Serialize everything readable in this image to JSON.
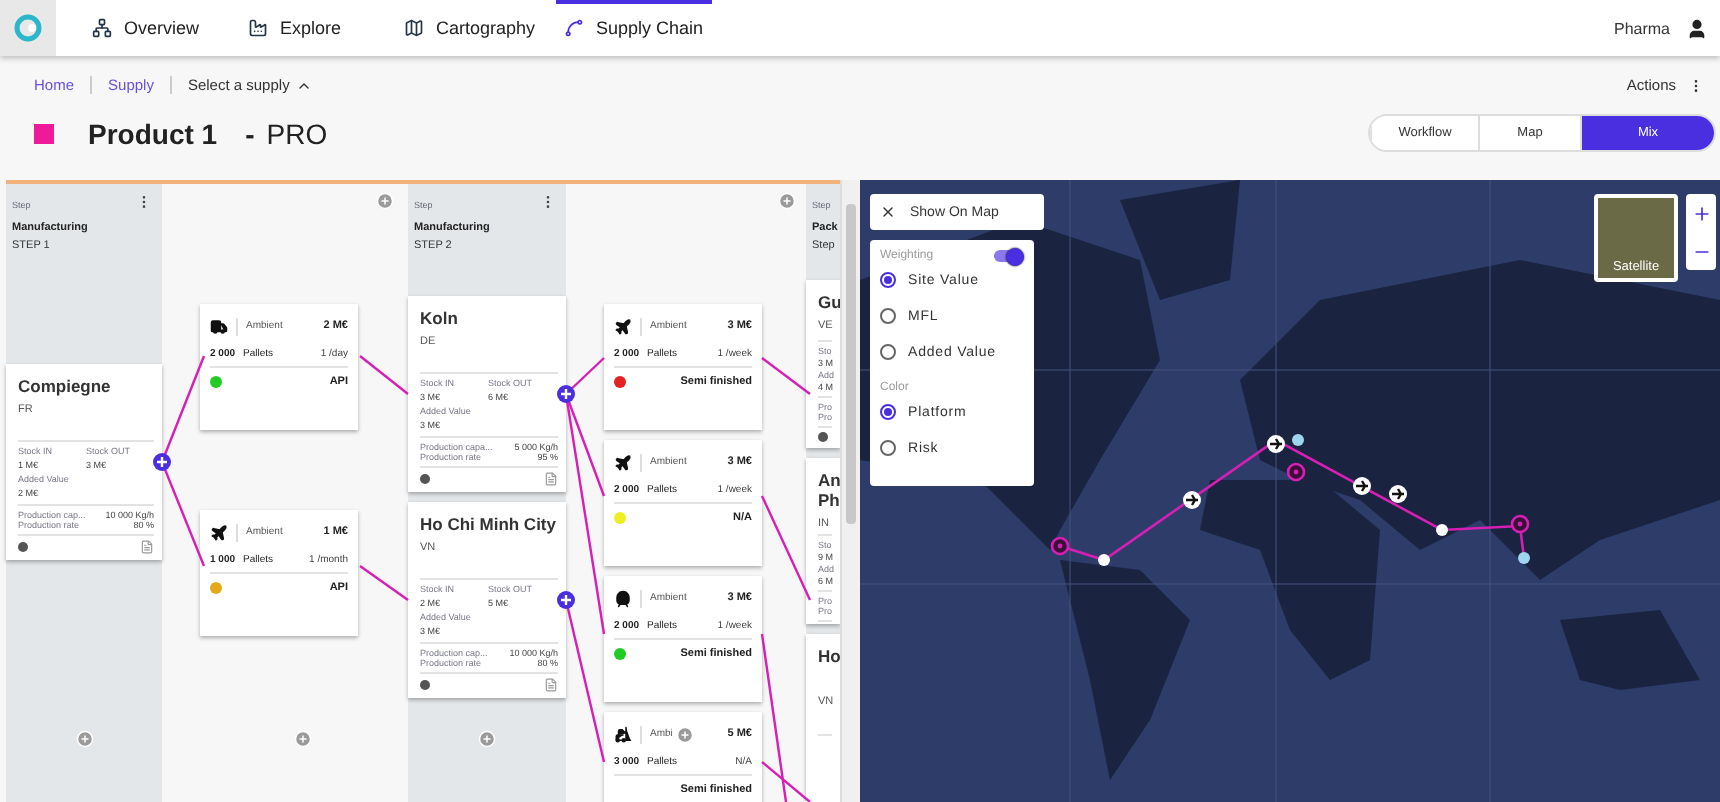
{
  "nav": {
    "items": [
      {
        "label": "Overview",
        "kind": "overview",
        "selected": false
      },
      {
        "label": "Explore",
        "kind": "explore",
        "selected": false
      },
      {
        "label": "Cartography",
        "kind": "cartography",
        "selected": false
      },
      {
        "label": "Supply Chain",
        "kind": "supply",
        "selected": true
      }
    ],
    "user": "Pharma"
  },
  "breadcrumbs": [
    {
      "label": "Home"
    },
    {
      "label": "Supply"
    }
  ],
  "supply_select": "Select a supply",
  "actions": "Actions",
  "product": {
    "name": "Product 1",
    "separator": "-",
    "code": "PRO",
    "color": "#ee1a9a"
  },
  "view_toggle": [
    {
      "label": "Workflow",
      "selected": false
    },
    {
      "label": "Map",
      "selected": false
    },
    {
      "label": "Mix",
      "selected": true
    }
  ],
  "steps": [
    {
      "caption": "Step",
      "type": "Manufacturing",
      "name": "STEP 1",
      "sites": [
        {
          "name": "Compiegne",
          "country": "FR",
          "stock_in_label": "Stock IN",
          "stock_in": "1 M€",
          "stock_out_label": "Stock OUT",
          "stock_out": "3 M€",
          "added_value_label": "Added Value",
          "added_value": "2 M€",
          "capacity_label": "Production cap...",
          "capacity": "10 000 Kg/h",
          "rate_label": "Production rate",
          "rate": "80 %"
        }
      ]
    },
    {
      "caption": "Step",
      "type": "Manufacturing",
      "name": "STEP 2",
      "sites": [
        {
          "name": "Koln",
          "country": "DE",
          "stock_in_label": "Stock IN",
          "stock_in": "3 M€",
          "stock_out_label": "Stock OUT",
          "stock_out": "6 M€",
          "added_value_label": "Added Value",
          "added_value": "3 M€",
          "capacity_label": "Production capa...",
          "capacity": "5 000 Kg/h",
          "rate_label": "Production rate",
          "rate": "95 %"
        },
        {
          "name": "Ho Chi Minh City",
          "country": "VN",
          "stock_in_label": "Stock IN",
          "stock_in": "2 M€",
          "stock_out_label": "Stock OUT",
          "stock_out": "5 M€",
          "added_value_label": "Added Value",
          "added_value": "3 M€",
          "capacity_label": "Production cap...",
          "capacity": "10 000 Kg/h",
          "rate_label": "Production rate",
          "rate": "80 %"
        }
      ]
    },
    {
      "caption": "Step",
      "type": "Pack",
      "name": "Step",
      "sites": [
        {
          "name": "Gu",
          "country": "VE",
          "stock_in_label": "Sto",
          "stock_in": "3 M",
          "added_value_label": "Add",
          "added_value": "4 M",
          "capacity_label": "Pro",
          "rate_label": "Pro"
        },
        {
          "name": "An Ph",
          "country": "IN",
          "stock_in_label": "Sto",
          "stock_in": "9 M",
          "added_value_label": "Add",
          "added_value": "6 M",
          "capacity_label": "Pro",
          "rate_label": "Pro"
        },
        {
          "name": "Ho",
          "country": "VN"
        }
      ]
    }
  ],
  "flows": [
    {
      "transports": [
        {
          "kind": "truck",
          "temp": "Ambient",
          "cost": "2 M€",
          "quantity": "2 000",
          "unit": "Pallets",
          "frequency": "1 /day",
          "color": "#22cc22",
          "product": "API"
        },
        {
          "kind": "plane",
          "temp": "Ambient",
          "cost": "1 M€",
          "quantity": "1 000",
          "unit": "Pallets",
          "frequency": "1 /month",
          "color": "#e8a81c",
          "product": "API"
        }
      ]
    },
    {
      "transports": [
        {
          "kind": "plane",
          "temp": "Ambient",
          "cost": "3 M€",
          "quantity": "2 000",
          "unit": "Pallets",
          "frequency": "1 /week",
          "color": "#e52222",
          "product": "Semi finished"
        },
        {
          "kind": "plane",
          "temp": "Ambient",
          "cost": "3 M€",
          "quantity": "2 000",
          "unit": "Pallets",
          "frequency": "1 /week",
          "color": "#eeee22",
          "product": "N/A"
        },
        {
          "kind": "train",
          "temp": "Ambient",
          "cost": "3 M€",
          "quantity": "2 000",
          "unit": "Pallets",
          "frequency": "1 /week",
          "color": "#22cc22",
          "product": "Semi finished"
        },
        {
          "kind": "forklift",
          "temp": "Ambi",
          "cost": "5 M€",
          "quantity": "3 000",
          "unit": "Pallets",
          "frequency": "N/A",
          "product": "Semi finished"
        }
      ]
    }
  ],
  "map": {
    "show_button": "Show On Map",
    "satellite": "Satellite",
    "weighting": {
      "label": "Weighting",
      "on": true,
      "options": [
        {
          "label": "Site Value",
          "selected": true
        },
        {
          "label": "MFL",
          "selected": false
        },
        {
          "label": "Added Value",
          "selected": false
        }
      ]
    },
    "color": {
      "label": "Color",
      "options": [
        {
          "label": "Platform",
          "selected": true
        },
        {
          "label": "Risk",
          "selected": false
        }
      ]
    }
  }
}
